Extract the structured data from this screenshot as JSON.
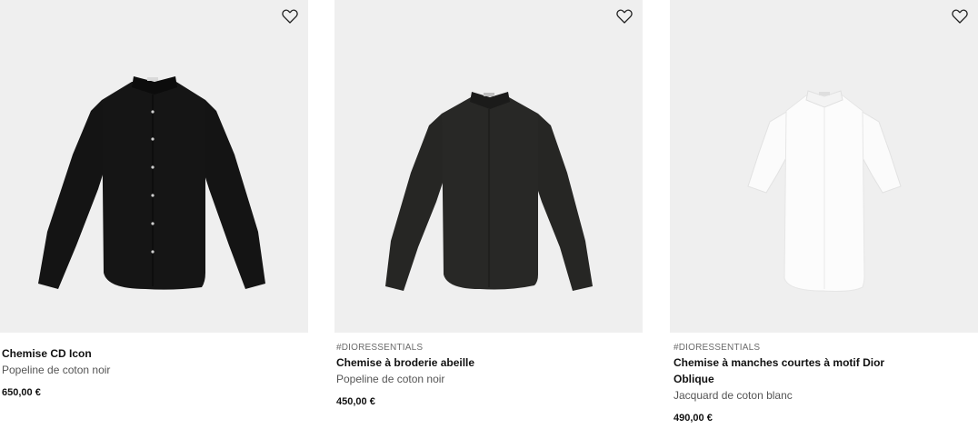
{
  "products": [
    {
      "tag": "",
      "name": "Chemise CD Icon",
      "description": "Popeline de coton noir",
      "price": "650,00 €",
      "image_icon": "black-shirt-image",
      "wishlist_icon": "heart-icon"
    },
    {
      "tag": "#DIORESSENTIALS",
      "name": "Chemise à broderie abeille",
      "description": "Popeline de coton noir",
      "price": "450,00 €",
      "image_icon": "black-shirt-image",
      "wishlist_icon": "heart-icon"
    },
    {
      "tag": "#DIORESSENTIALS",
      "name": "Chemise à manches courtes à motif Dior Oblique",
      "description": "Jacquard de coton blanc",
      "price": "490,00 €",
      "image_icon": "white-short-sleeve-shirt-image",
      "wishlist_icon": "heart-icon"
    }
  ],
  "colors": {
    "tile_background": "#efefef",
    "black_shirt": "#151515",
    "dark_shirt": "#262624",
    "white_shirt": "#fbfbfb"
  }
}
